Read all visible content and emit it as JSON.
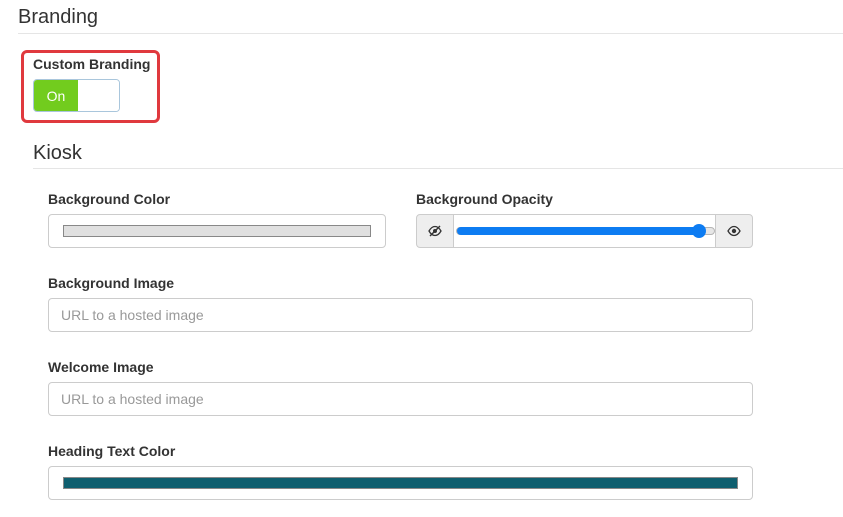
{
  "branding": {
    "title": "Branding",
    "custom_branding": {
      "label": "Custom Branding",
      "toggle_label": "On",
      "enabled": true,
      "on_color": "#72cc1e"
    }
  },
  "kiosk": {
    "title": "Kiosk",
    "background_color": {
      "label": "Background Color",
      "value": "#e0e0e0"
    },
    "background_opacity": {
      "label": "Background Opacity",
      "value_fraction": 0.94,
      "left_icon": "eye-slash-icon",
      "right_icon": "eye-icon",
      "accent_color": "#0d7cf2"
    },
    "background_image": {
      "label": "Background Image",
      "value": "",
      "placeholder": "URL to a hosted image"
    },
    "welcome_image": {
      "label": "Welcome Image",
      "value": "",
      "placeholder": "URL to a hosted image"
    },
    "heading_text_color": {
      "label": "Heading Text Color",
      "value": "#0f5f6f"
    }
  },
  "highlight_color": "#e0393e"
}
